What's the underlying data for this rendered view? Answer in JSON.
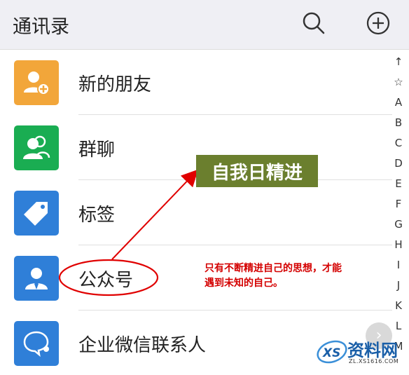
{
  "header": {
    "title": "通讯录",
    "search_icon": "search-icon",
    "add_icon": "add-circle-icon"
  },
  "contacts": {
    "items": [
      {
        "label": "新的朋友",
        "icon": "add-friend-icon",
        "color": "#f2a63a"
      },
      {
        "label": "群聊",
        "icon": "group-chat-icon",
        "color": "#1aad52"
      },
      {
        "label": "标签",
        "icon": "tag-icon",
        "color": "#2f7fd8"
      },
      {
        "label": "公众号",
        "icon": "official-account-icon",
        "color": "#2f7fd8"
      },
      {
        "label": "企业微信联系人",
        "icon": "enterprise-contact-icon",
        "color": "#2f7fd8"
      }
    ]
  },
  "index_bar": {
    "letters": [
      "↑",
      "☆",
      "A",
      "B",
      "C",
      "D",
      "E",
      "F",
      "G",
      "H",
      "I",
      "J",
      "K",
      "L",
      "M"
    ]
  },
  "annotation": {
    "box_text": "自我日精进",
    "note_line1": "只有不断精进自己的思想，才能",
    "note_line2": "遇到未知的自己。",
    "box_color": "#6b7f2e",
    "note_color": "#d40000"
  },
  "watermark": {
    "text": "资料网",
    "url": "ZL.XS1616.COM",
    "logo_letters": "XS"
  }
}
